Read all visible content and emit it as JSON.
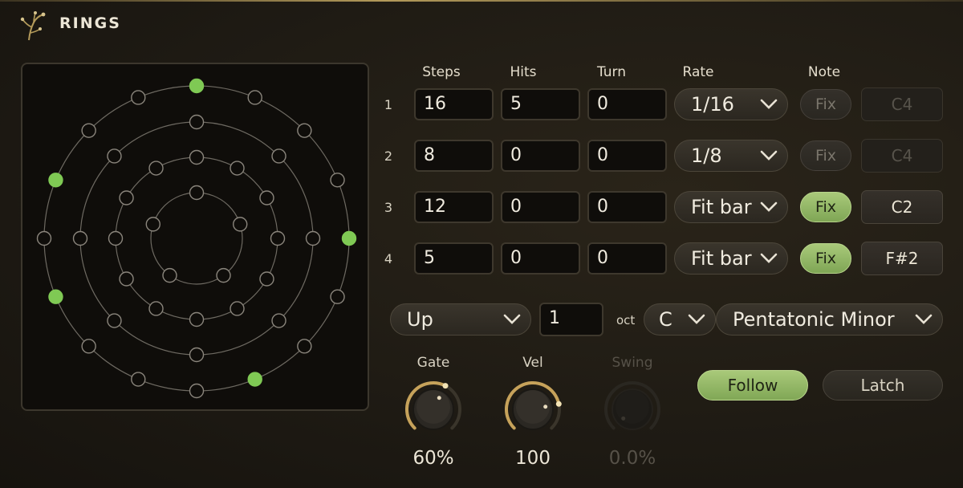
{
  "header": {
    "title": "RINGS",
    "logo_icon": "branch-icon"
  },
  "columns": {
    "steps": "Steps",
    "hits": "Hits",
    "turn": "Turn",
    "rate": "Rate",
    "note": "Note"
  },
  "rows": [
    {
      "num": "1",
      "steps": "16",
      "hits": "5",
      "turn": "0",
      "rate": "1/16",
      "fix": "Fix",
      "fix_active": false,
      "note": "C4",
      "note_active": false
    },
    {
      "num": "2",
      "steps": "8",
      "hits": "0",
      "turn": "0",
      "rate": "1/8",
      "fix": "Fix",
      "fix_active": false,
      "note": "C4",
      "note_active": false
    },
    {
      "num": "3",
      "steps": "12",
      "hits": "0",
      "turn": "0",
      "rate": "Fit bar",
      "fix": "Fix",
      "fix_active": true,
      "note": "C2",
      "note_active": true
    },
    {
      "num": "4",
      "steps": "5",
      "hits": "0",
      "turn": "0",
      "rate": "Fit bar",
      "fix": "Fix",
      "fix_active": true,
      "note": "F#2",
      "note_active": true
    }
  ],
  "direction": {
    "value": "Up"
  },
  "octave": {
    "value": "1",
    "label": "oct"
  },
  "key": {
    "value": "C"
  },
  "scale": {
    "value": "Pentatonic Minor"
  },
  "knobs": {
    "gate": {
      "label": "Gate",
      "value": "60%",
      "level": 0.6
    },
    "vel": {
      "label": "Vel",
      "value": "100",
      "level": 0.79
    },
    "swing": {
      "label": "Swing",
      "value": "0.0%",
      "level": 0.0,
      "disabled": true
    }
  },
  "buttons": {
    "follow": "Follow",
    "follow_active": true,
    "latch": "Latch",
    "latch_active": false
  },
  "rings": [
    {
      "steps": 16,
      "active": [
        0,
        4,
        7,
        11,
        13
      ]
    },
    {
      "steps": 8,
      "active": []
    },
    {
      "steps": 12,
      "active": []
    },
    {
      "steps": 5,
      "active": []
    }
  ],
  "colors": {
    "accent": "#7fc954",
    "accent_fill": "#a9c97a",
    "panel": "#0f0d0a",
    "ring_line": "#6e6a62"
  }
}
